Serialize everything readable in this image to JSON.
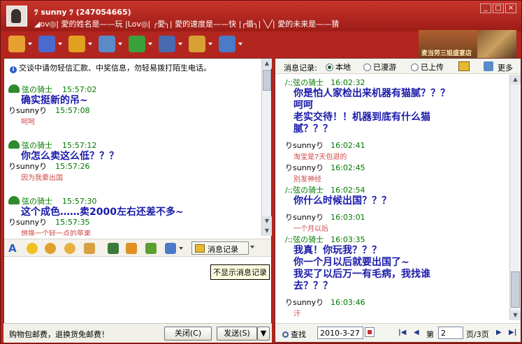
{
  "window": {
    "title": "ﾂ sunny ﾂ (247054665)",
    "signature": "◢ov◎| 愛的姓名是——玩  |Lov◎|  ╭愛╮|  愛的速度是——快  |╭循╮|  ╲╱|  愛的未来是——猜",
    "min_label": "_",
    "max_label": "□",
    "close_label": "×",
    "banner_text": "麦当劳三姐盛宴店"
  },
  "toolbar": {
    "icons": [
      {
        "name": "video-icon",
        "color": "#e8a030"
      },
      {
        "name": "voice-icon",
        "color": "#4a6ad0"
      },
      {
        "name": "file-transfer-icon",
        "color": "#e0a020"
      },
      {
        "name": "email-icon",
        "color": "#5a8ac8"
      },
      {
        "name": "create-group-icon",
        "color": "#3aa03a"
      },
      {
        "name": "remote-assist-icon",
        "color": "#4a6ab0"
      },
      {
        "name": "game-icon",
        "color": "#d8a030"
      },
      {
        "name": "app-icon",
        "color": "#4a7ac8"
      }
    ]
  },
  "chat": {
    "notice": "交谈中请勿轻信汇款、中奖信息，勿轻易拨打陌生电话。",
    "messages": [
      {
        "sender": "弦の骑士",
        "time": "15:57:02",
        "text": "确实挺新的吊~"
      },
      {
        "sender": "りsunnyり",
        "time": "15:57:08",
        "text": "呵呵",
        "style": "reply"
      },
      {
        "sender": "弦の骑士",
        "time": "15:57:12",
        "text": "你怎么卖这么低？？？"
      },
      {
        "sender": "りsunnyり",
        "time": "15:57:26",
        "text": "因为我要出国",
        "style": "reply"
      },
      {
        "sender": "弦の骑士",
        "time": "15:57:30",
        "text": "这个成色……卖2000左右还差不多~"
      },
      {
        "sender": "りsunnyり",
        "time": "15:57:35",
        "text": "想换一个轻一点的苹果",
        "style": "reply"
      }
    ],
    "scroll_up": "▲",
    "scroll_down": "▼",
    "scroll_down2": "▼",
    "message_log_button": "消息记录",
    "tooltip": "不显示消息记录",
    "ad_text": "购物包邮费，退换货免邮费！",
    "close_button": "关闭(C)",
    "send_button": "发送(S)",
    "send_arrow": "▼"
  },
  "history": {
    "label": "消息记录:",
    "options": [
      {
        "label": "本地",
        "selected": true
      },
      {
        "label": "已漫游",
        "selected": false
      },
      {
        "label": "已上传",
        "selected": false
      }
    ],
    "more": "更多",
    "messages": [
      {
        "sender": "/:;弦の骑士",
        "time": "16:02:32",
        "lines": [
          "你是怕人家检出来机器有猫腻？？？",
          "呵呵",
          "老实交待！！机器到底有什么猫",
          "腻？？？"
        ]
      },
      {
        "sender": "りsunnyり",
        "time": "16:02:41",
        "lines": [
          "淘宝是7天包退的"
        ],
        "style": "reply"
      },
      {
        "sender": "りsunnyり",
        "time": "16:02:45",
        "lines": [
          "别发神经"
        ],
        "style": "reply"
      },
      {
        "sender": "/:;弦の骑士",
        "time": "16:02:54",
        "lines": [
          "你什么时候出国？？？"
        ]
      },
      {
        "sender": "りsunnyり",
        "time": "16:03:01",
        "lines": [
          "一个月以后"
        ],
        "style": "reply"
      },
      {
        "sender": "/:;弦の骑士",
        "time": "16:03:35",
        "lines": [
          "我真！你玩我？？？",
          "你一个月以后就要出国了~",
          "我买了以后万一有毛病，我找谁",
          "去？？？"
        ]
      },
      {
        "sender": "りsunnyり",
        "time": "16:03:46",
        "lines": [
          "汗"
        ],
        "style": "reply"
      }
    ],
    "search_label": "查找",
    "date": "2010-3-27",
    "first": "|◀",
    "prev": "◀",
    "page_label": "第",
    "page": "2",
    "page_total": "页/3页",
    "next": "▶",
    "last": "▶|",
    "scroll_up": "▲",
    "scroll_down": "▼"
  }
}
